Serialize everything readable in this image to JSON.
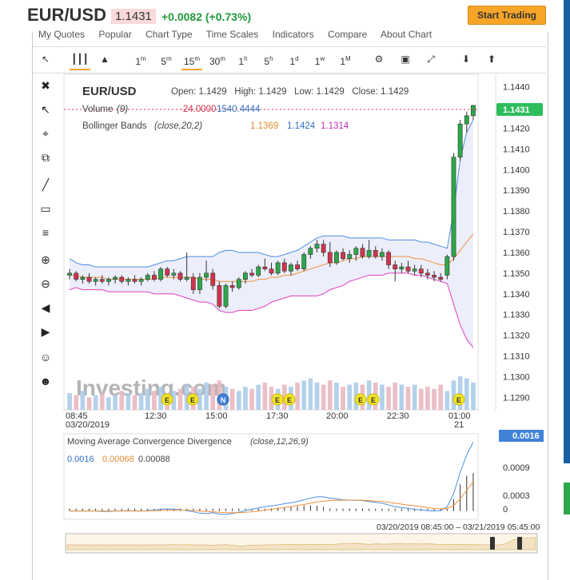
{
  "header": {
    "symbol": "EUR/USD",
    "last": "1.1431",
    "change": "+0.0082 (+0.73%)",
    "cta": "Start Trading"
  },
  "menu": [
    "My Quotes",
    "Popular",
    "Chart Type",
    "Time Scales",
    "Indicators",
    "Compare",
    "About Chart"
  ],
  "timeframes": [
    "1m",
    "5m",
    "15m",
    "30m",
    "1h",
    "5h",
    "1d",
    "1w",
    "1M"
  ],
  "selected_timeframe": "15m",
  "legend": {
    "symbol": "EUR/USD",
    "ohlc": "Open: 1.1429   High: 1.1429   Low: 1.1429   Close: 1.1429",
    "volume_label": "Volume",
    "volume_period": "(9)",
    "volume_val1": "-24.0000",
    "volume_val2": "1540.4444",
    "bb_label": "Bollinger Bands",
    "bb_params": "(close,20,2)",
    "bb_mid": "1.1369",
    "bb_upper": "1.1424",
    "bb_lower": "1.1314"
  },
  "macd": {
    "label": "Moving Average Convergence Divergence",
    "params": "(close,12,26,9)",
    "v1": "0.0016",
    "v2": "0.00068",
    "v3": "0.00088",
    "axis_ticks": [
      "0.0009",
      "0.0003",
      "0"
    ],
    "current": "0.0016"
  },
  "range_text": "03/20/2019 08:45:00 – 03/21/2019 05:45:00",
  "watermark": "Investing.com",
  "colors": {
    "up": "#2ca84a",
    "down": "#d4344c",
    "bb_upper": "#4a8fe0",
    "bb_lower": "#e040c0",
    "bb_mid": "#f0903a",
    "price_badge": "#2dbd5c"
  },
  "chart_data": {
    "type": "candlestick",
    "price_axis_ticks": [
      "1.1440",
      "1.1430",
      "1.1420",
      "1.1410",
      "1.1400",
      "1.1390",
      "1.1380",
      "1.1370",
      "1.1360",
      "1.1350",
      "1.1340",
      "1.1330",
      "1.1320",
      "1.1310",
      "1.1300",
      "1.1290"
    ],
    "ylim": [
      1.1284,
      1.1446
    ],
    "current_price": "1.1431",
    "time_labels": [
      "08:45",
      "12:30",
      "15:00",
      "17:30",
      "20:00",
      "22:30",
      "01:00"
    ],
    "date_labels": [
      "03/20/2019",
      "21"
    ],
    "event_markers": [
      "E",
      "E",
      "N",
      "E",
      "E",
      "E",
      "E",
      "E"
    ],
    "candles": [
      [
        1.1349,
        1.1352,
        1.1347,
        1.135
      ],
      [
        1.135,
        1.1351,
        1.1346,
        1.1347
      ],
      [
        1.1347,
        1.1349,
        1.1345,
        1.1348
      ],
      [
        1.1348,
        1.135,
        1.1345,
        1.1346
      ],
      [
        1.1346,
        1.1348,
        1.1344,
        1.1347
      ],
      [
        1.1347,
        1.1349,
        1.1345,
        1.1346
      ],
      [
        1.1346,
        1.1348,
        1.1344,
        1.1347
      ],
      [
        1.1347,
        1.1349,
        1.1345,
        1.1348
      ],
      [
        1.1348,
        1.1349,
        1.1345,
        1.1346
      ],
      [
        1.1346,
        1.1348,
        1.1344,
        1.1347
      ],
      [
        1.1347,
        1.1349,
        1.1345,
        1.1346
      ],
      [
        1.1346,
        1.1348,
        1.1344,
        1.1347
      ],
      [
        1.1347,
        1.135,
        1.1346,
        1.1349
      ],
      [
        1.1349,
        1.1351,
        1.1346,
        1.1347
      ],
      [
        1.1347,
        1.1353,
        1.1346,
        1.1352
      ],
      [
        1.1352,
        1.1353,
        1.1348,
        1.1349
      ],
      [
        1.1349,
        1.1352,
        1.1347,
        1.135
      ],
      [
        1.135,
        1.1351,
        1.1346,
        1.1347
      ],
      [
        1.1347,
        1.136,
        1.1346,
        1.1348
      ],
      [
        1.1348,
        1.135,
        1.134,
        1.1342
      ],
      [
        1.1342,
        1.135,
        1.134,
        1.1348
      ],
      [
        1.1348,
        1.1356,
        1.1346,
        1.135
      ],
      [
        1.135,
        1.1352,
        1.1342,
        1.1344
      ],
      [
        1.1344,
        1.1346,
        1.1333,
        1.1334
      ],
      [
        1.1334,
        1.1345,
        1.1333,
        1.1344
      ],
      [
        1.1344,
        1.1346,
        1.1341,
        1.1343
      ],
      [
        1.1343,
        1.1348,
        1.1342,
        1.1347
      ],
      [
        1.1347,
        1.1351,
        1.1345,
        1.135
      ],
      [
        1.135,
        1.1352,
        1.1348,
        1.1349
      ],
      [
        1.1349,
        1.1354,
        1.1348,
        1.1353
      ],
      [
        1.1353,
        1.1357,
        1.1351,
        1.1352
      ],
      [
        1.1352,
        1.1355,
        1.1349,
        1.135
      ],
      [
        1.135,
        1.1356,
        1.1349,
        1.1355
      ],
      [
        1.1355,
        1.1357,
        1.135,
        1.1351
      ],
      [
        1.1351,
        1.1355,
        1.1349,
        1.1354
      ],
      [
        1.1354,
        1.1356,
        1.1351,
        1.1352
      ],
      [
        1.1352,
        1.136,
        1.1351,
        1.1359
      ],
      [
        1.1359,
        1.1363,
        1.1357,
        1.1362
      ],
      [
        1.1362,
        1.1366,
        1.136,
        1.1364
      ],
      [
        1.1364,
        1.1366,
        1.1358,
        1.136
      ],
      [
        1.136,
        1.1365,
        1.1353,
        1.1355
      ],
      [
        1.1355,
        1.1361,
        1.1354,
        1.136
      ],
      [
        1.136,
        1.1362,
        1.1356,
        1.1357
      ],
      [
        1.1357,
        1.1361,
        1.1355,
        1.1359
      ],
      [
        1.1359,
        1.1363,
        1.1356,
        1.1362
      ],
      [
        1.1362,
        1.1364,
        1.1357,
        1.1358
      ],
      [
        1.1358,
        1.1366,
        1.1357,
        1.1361
      ],
      [
        1.1361,
        1.1363,
        1.1357,
        1.1358
      ],
      [
        1.1358,
        1.1362,
        1.1356,
        1.136
      ],
      [
        1.136,
        1.1361,
        1.1352,
        1.1354
      ],
      [
        1.1354,
        1.1356,
        1.1346,
        1.1352
      ],
      [
        1.1352,
        1.1355,
        1.135,
        1.1353
      ],
      [
        1.1353,
        1.1356,
        1.135,
        1.1351
      ],
      [
        1.1351,
        1.1354,
        1.1349,
        1.1352
      ],
      [
        1.1352,
        1.1354,
        1.1348,
        1.135
      ],
      [
        1.135,
        1.1352,
        1.1347,
        1.1349
      ],
      [
        1.1349,
        1.1351,
        1.1346,
        1.1348
      ],
      [
        1.1348,
        1.135,
        1.1346,
        1.1347
      ],
      [
        1.1349,
        1.1359,
        1.1347,
        1.1358
      ],
      [
        1.1358,
        1.1408,
        1.1356,
        1.1406
      ],
      [
        1.1406,
        1.1424,
        1.1404,
        1.1422
      ],
      [
        1.1422,
        1.1428,
        1.1418,
        1.1426
      ],
      [
        1.1426,
        1.1431,
        1.1424,
        1.1431
      ]
    ],
    "bb_upper": [
      1.1357,
      1.1355,
      1.1354,
      1.1354,
      1.1353,
      1.1353,
      1.1353,
      1.1353,
      1.1353,
      1.1353,
      1.1353,
      1.1353,
      1.1353,
      1.1354,
      1.1355,
      1.1356,
      1.1356,
      1.1357,
      1.1358,
      1.1358,
      1.1358,
      1.1358,
      1.1358,
      1.136,
      1.1361,
      1.1361,
      1.136,
      1.136,
      1.136,
      1.136,
      1.1359,
      1.1358,
      1.1358,
      1.1359,
      1.136,
      1.1361,
      1.1363,
      1.1365,
      1.1367,
      1.1368,
      1.1368,
      1.1368,
      1.1368,
      1.1367,
      1.1367,
      1.1367,
      1.1367,
      1.1367,
      1.1367,
      1.1366,
      1.1366,
      1.1366,
      1.1366,
      1.1366,
      1.1365,
      1.1365,
      1.1364,
      1.1363,
      1.1362,
      1.138,
      1.1405,
      1.1418,
      1.1424
    ],
    "bb_mid": [
      1.1349,
      1.1349,
      1.1348,
      1.1348,
      1.1348,
      1.1348,
      1.1347,
      1.1347,
      1.1347,
      1.1347,
      1.1347,
      1.1347,
      1.1347,
      1.1347,
      1.1348,
      1.1348,
      1.1348,
      1.1348,
      1.1348,
      1.1348,
      1.1347,
      1.1347,
      1.1347,
      1.1346,
      1.1346,
      1.1346,
      1.1346,
      1.1346,
      1.1346,
      1.1347,
      1.1347,
      1.1348,
      1.1348,
      1.1349,
      1.1349,
      1.135,
      1.1351,
      1.1352,
      1.1353,
      1.1354,
      1.1355,
      1.1355,
      1.1356,
      1.1357,
      1.1357,
      1.1358,
      1.1358,
      1.1358,
      1.1358,
      1.1358,
      1.1358,
      1.1358,
      1.1358,
      1.1357,
      1.1357,
      1.1356,
      1.1355,
      1.1354,
      1.1354,
      1.1357,
      1.1361,
      1.1365,
      1.1369
    ],
    "bb_lower": [
      1.1342,
      1.1343,
      1.1342,
      1.1342,
      1.1342,
      1.1342,
      1.1341,
      1.1341,
      1.1341,
      1.1341,
      1.1341,
      1.1341,
      1.1341,
      1.134,
      1.134,
      1.134,
      1.134,
      1.1339,
      1.1338,
      1.1337,
      1.1336,
      1.1336,
      1.1335,
      1.1332,
      1.1331,
      1.1331,
      1.1332,
      1.1332,
      1.1332,
      1.1333,
      1.1334,
      1.1336,
      1.1337,
      1.1338,
      1.1339,
      1.1339,
      1.1339,
      1.1339,
      1.1339,
      1.134,
      1.1342,
      1.1343,
      1.1344,
      1.1346,
      1.1347,
      1.1348,
      1.1349,
      1.1349,
      1.1349,
      1.135,
      1.135,
      1.135,
      1.135,
      1.1349,
      1.1349,
      1.1348,
      1.1347,
      1.1346,
      1.1345,
      1.1335,
      1.1325,
      1.1318,
      1.1314
    ],
    "volume": [
      8,
      7,
      9,
      6,
      7,
      8,
      6,
      7,
      9,
      8,
      7,
      8,
      10,
      9,
      11,
      8,
      9,
      10,
      12,
      11,
      10,
      13,
      12,
      14,
      11,
      10,
      9,
      11,
      10,
      12,
      13,
      11,
      10,
      12,
      11,
      13,
      14,
      15,
      13,
      12,
      14,
      13,
      11,
      12,
      13,
      12,
      14,
      13,
      12,
      11,
      13,
      12,
      11,
      12,
      10,
      11,
      10,
      12,
      9,
      14,
      16,
      15,
      13
    ],
    "macd_line": [
      0,
      0,
      0,
      0,
      0,
      -1e-05,
      -1e-05,
      0,
      0,
      1e-05,
      0,
      0,
      1e-05,
      2e-05,
      4e-05,
      5e-05,
      4e-05,
      3e-05,
      1e-05,
      -2e-05,
      -5e-05,
      -6e-05,
      -4e-05,
      -7e-05,
      -8e-05,
      -6e-05,
      -3e-05,
      1e-05,
      4e-05,
      7e-05,
      0.0001,
      0.00012,
      0.00014,
      0.00017,
      0.00019,
      0.00022,
      0.00026,
      0.0003,
      0.00033,
      0.00033,
      0.0003,
      0.00028,
      0.00026,
      0.00025,
      0.00025,
      0.00024,
      0.00022,
      0.0002,
      0.00018,
      0.00014,
      0.0001,
      8e-05,
      6e-05,
      4e-05,
      2e-05,
      1e-05,
      0,
      1e-05,
      0.0001,
      0.0004,
      0.0009,
      0.0013,
      0.0016
    ],
    "macd_signal": [
      0,
      0,
      0,
      0,
      0,
      0,
      0,
      0,
      0,
      0,
      0,
      0,
      0,
      1e-05,
      1e-05,
      2e-05,
      2e-05,
      2e-05,
      2e-05,
      1e-05,
      0,
      -1e-05,
      -2e-05,
      -3e-05,
      -4e-05,
      -4e-05,
      -4e-05,
      -3e-05,
      -2e-05,
      0,
      2e-05,
      4e-05,
      6e-05,
      8e-05,
      0.0001,
      0.00013,
      0.00015,
      0.00018,
      0.00021,
      0.00023,
      0.00024,
      0.00025,
      0.00025,
      0.00025,
      0.00025,
      0.00025,
      0.00024,
      0.00023,
      0.00022,
      0.0002,
      0.00018,
      0.00016,
      0.00014,
      0.00012,
      0.0001,
      8e-05,
      6e-05,
      5e-05,
      6e-05,
      0.00013,
      0.00028,
      0.00048,
      0.00068
    ],
    "macd_hist": [
      0,
      0,
      0,
      0,
      0,
      0,
      0,
      0,
      0,
      0,
      0,
      0,
      0,
      0,
      0,
      0,
      0,
      0,
      0,
      0,
      0,
      0,
      0,
      0,
      0,
      0,
      0,
      0,
      0,
      3e-05,
      5e-05,
      6e-05,
      8e-05,
      9e-05,
      0.0001,
      0.00011,
      0.00013,
      0.00013,
      0.00012,
      0.0001,
      6e-05,
      3e-05,
      1e-05,
      0,
      0,
      0,
      0,
      0,
      0,
      0,
      0,
      0,
      0,
      0,
      0,
      0,
      0,
      0,
      4e-05,
      0.00027,
      0.00062,
      0.00082,
      0.00088
    ]
  }
}
